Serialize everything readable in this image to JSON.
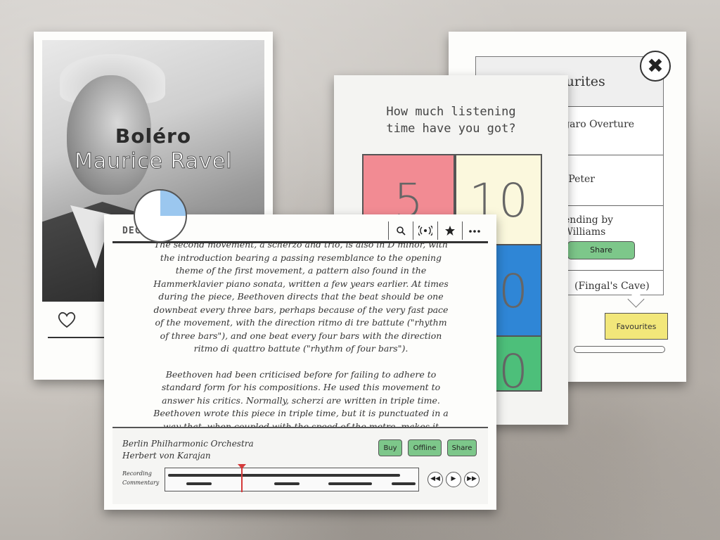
{
  "bolero": {
    "title": "Boléro",
    "composer": "Maurice Ravel"
  },
  "time_card": {
    "question_line1": "How much listening",
    "question_line2": "time have you got?",
    "options": [
      "5",
      "10",
      "20",
      "20"
    ],
    "colors": [
      "#f28b93",
      "#fbf8dd",
      "#2f86d6",
      "#4dbf7a"
    ]
  },
  "favourites": {
    "title": "Favourites",
    "items": [
      {
        "text": "Figaro Overture\nart"
      },
      {
        "text": "by Peter"
      },
      {
        "text": "scending by\nn Williams",
        "button": "Share"
      },
      {
        "text": "(Fingal's Cave)"
      }
    ],
    "tab_label": "Favourites",
    "close_symbol": "✖"
  },
  "decca": {
    "logo": "DECCA 100",
    "header_icons": [
      "search-icon",
      "broadcast-icon",
      "star-icon",
      "more-icon"
    ],
    "paragraphs": [
      "The second movement, a scherzo and trio, is also in D minor, with the introduction bearing a passing resemblance to the opening theme of the first movement, a pattern also found in the Hammerklavier piano sonata, written a few years earlier. At times during the piece, Beethoven directs that the beat should be one downbeat every three bars, perhaps because of the very fast pace of the movement, with the direction ritmo di tre battute (\"rhythm of three bars\"), and one beat every four bars with the direction ritmo di quattro battute (\"rhythm of four bars\").",
      "Beethoven had been criticised before for failing to adhere to standard form for his compositions. He used this movement to answer his critics. Normally, scherzi are written in triple time. Beethoven wrote this piece in triple time, but it is punctuated in a way that, when coupled with the speed of the metre, makes it sound"
    ],
    "orchestra": "Berlin Philharmonic Orchestra",
    "conductor": "Herbert von Karajan",
    "buttons": {
      "buy": "Buy",
      "offline": "Offline",
      "share": "Share"
    },
    "labels": {
      "recording": "Recording",
      "commentary": "Commentary"
    },
    "controls": {
      "prev": "◀◀",
      "play": "▶",
      "next": "▶▶"
    }
  }
}
